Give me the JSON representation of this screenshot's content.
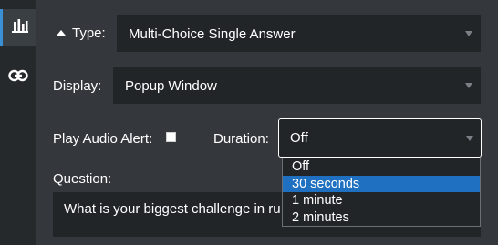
{
  "sidebar": {
    "items": [
      {
        "icon": "bar-chart-icon",
        "active": true
      },
      {
        "icon": "link-icon",
        "active": false
      }
    ]
  },
  "form": {
    "type": {
      "label": "Type:",
      "value": "Multi-Choice Single Answer"
    },
    "display": {
      "label": "Display:",
      "value": "Popup Window"
    },
    "audio": {
      "label": "Play Audio Alert:",
      "checked": false
    },
    "duration": {
      "label": "Duration:",
      "value": "Off",
      "options": [
        "Off",
        "30 seconds",
        "1 minute",
        "2 minutes"
      ],
      "highlighted": "30 seconds"
    },
    "question": {
      "label": "Question:",
      "value": "What is your biggest challenge in ru"
    }
  },
  "colors": {
    "accent": "#3b8fd4",
    "highlight": "#1f70c1",
    "panel": "#34383c",
    "field": "#222528"
  }
}
